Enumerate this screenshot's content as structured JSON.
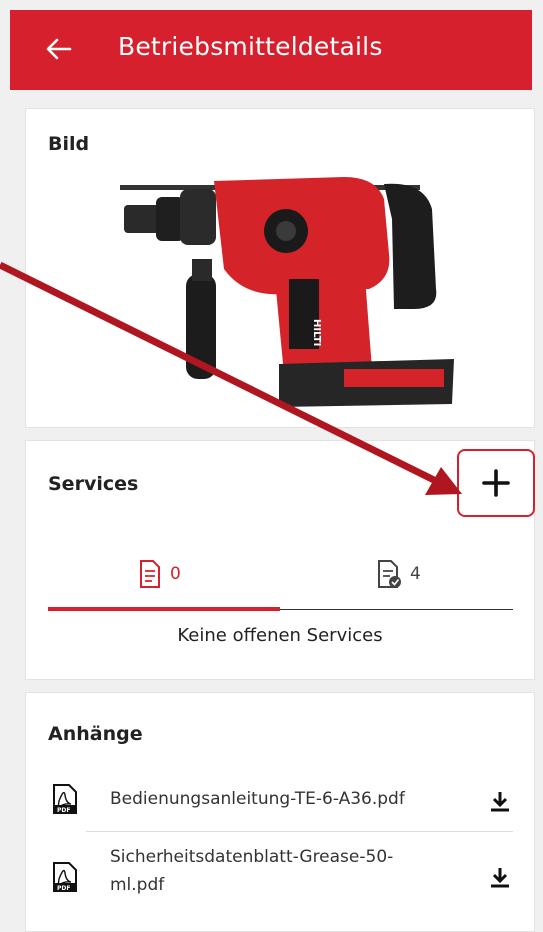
{
  "header": {
    "title": "Betriebsmitteldetails",
    "back_icon": "arrow-left-icon"
  },
  "image_card": {
    "title": "Bild",
    "image": "hammer-drill-product-image"
  },
  "services": {
    "title": "Services",
    "add_icon": "plus-icon",
    "tabs": [
      {
        "icon": "document-icon",
        "count": "0",
        "active": true
      },
      {
        "icon": "document-check-icon",
        "count": "4",
        "active": false
      }
    ],
    "empty_text": "Keine offenen Services"
  },
  "attachments": {
    "title": "Anhänge",
    "items": [
      {
        "icon": "pdf-file-icon",
        "name": "Bedienungsanleitung-TE-6-A36.pdf",
        "action_icon": "download-icon"
      },
      {
        "icon": "pdf-file-icon",
        "name_line1": "Sicherheitsdatenblatt-Grease-50-",
        "name_line2": "ml.pdf",
        "action_icon": "download-icon"
      }
    ]
  },
  "colors": {
    "brand": "#d7202d",
    "background": "#f0f0f0"
  }
}
